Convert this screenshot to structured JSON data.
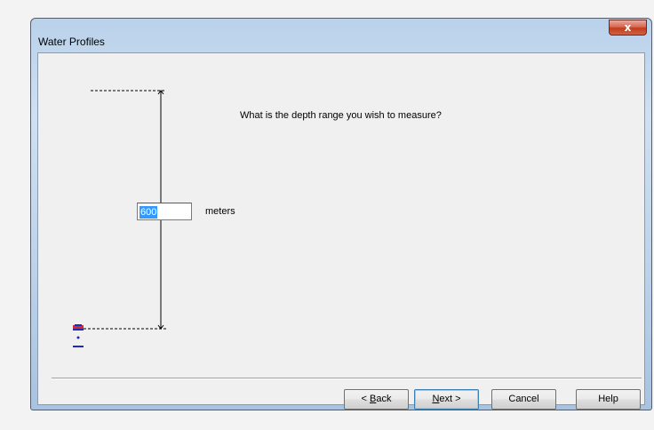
{
  "window": {
    "title": "Water Profiles",
    "close_glyph": "x"
  },
  "question": "What is the depth range you wish to measure?",
  "depth": {
    "value": "600",
    "unit": "meters"
  },
  "buttons": {
    "back_prefix": "< ",
    "back_key": "B",
    "back_rest": "ack",
    "next_key": "N",
    "next_rest": "ext >",
    "cancel": "Cancel",
    "help": "Help"
  },
  "icons": {
    "sensor": "sensor-icon",
    "close": "close-icon"
  },
  "colors": {
    "selection": "#3399ff",
    "sensor_top": "#d42a2a",
    "sensor_body": "#1f2ab8"
  }
}
